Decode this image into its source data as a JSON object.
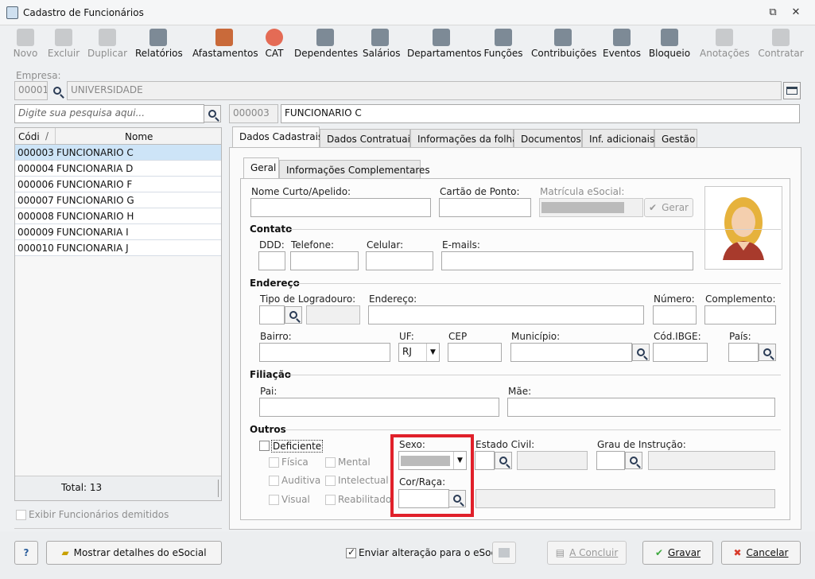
{
  "window": {
    "title": "Cadastro de Funcionários"
  },
  "toolbar": [
    {
      "label": "Novo",
      "icon": "new-doc-icon",
      "enabled": false
    },
    {
      "label": "Excluir",
      "icon": "trash-icon",
      "enabled": false
    },
    {
      "label": "Duplicar",
      "icon": "duplicate-users-icon",
      "enabled": false
    },
    {
      "label": "Relatórios",
      "icon": "report-icon",
      "enabled": true
    },
    {
      "label": "Afastamentos",
      "icon": "house-arrow-icon",
      "enabled": true
    },
    {
      "label": "CAT",
      "icon": "red-cross-icon",
      "enabled": true
    },
    {
      "label": "Dependentes",
      "icon": "dependents-icon",
      "enabled": true
    },
    {
      "label": "Salários",
      "icon": "money-icon",
      "enabled": true
    },
    {
      "label": "Departamentos",
      "icon": "desk-icon",
      "enabled": true
    },
    {
      "label": "Funções",
      "icon": "clipboard-icon",
      "enabled": true
    },
    {
      "label": "Contribuições",
      "icon": "heads-icon",
      "enabled": true
    },
    {
      "label": "Eventos",
      "icon": "list-icon",
      "enabled": true
    },
    {
      "label": "Bloqueio",
      "icon": "lock-icon",
      "enabled": true
    },
    {
      "label": "Anotações",
      "icon": "note-check-icon",
      "enabled": false
    },
    {
      "label": "Contratar",
      "icon": "contract-check-icon",
      "enabled": false
    }
  ],
  "empresa": {
    "label": "Empresa:",
    "code": "00001",
    "name": "UNIVERSIDADE"
  },
  "search": {
    "placeholder": "Digite sua pesquisa aqui..."
  },
  "current": {
    "code": "000003",
    "name": "FUNCIONARIO C"
  },
  "list": {
    "col_code": "Códi",
    "col_name": "Nome",
    "rows": [
      {
        "code": "000003",
        "name": "FUNCIONARIO C",
        "selected": true
      },
      {
        "code": "000004",
        "name": "FUNCIONARIA D"
      },
      {
        "code": "000006",
        "name": "FUNCIONARIO F"
      },
      {
        "code": "000007",
        "name": "FUNCIONARIO G"
      },
      {
        "code": "000008",
        "name": "FUNCIONARIO H"
      },
      {
        "code": "000009",
        "name": "FUNCIONARIA I"
      },
      {
        "code": "000010",
        "name": "FUNCIONARIA J"
      }
    ],
    "total": "Total: 13"
  },
  "exibir_demitidos": "Exibir Funcionários demitidos",
  "main_tabs": [
    "Dados Cadastrais",
    "Dados Contratuais",
    "Informações da folha",
    "Documentos",
    "Inf. adicionais",
    "Gestão"
  ],
  "sub_tabs": [
    "Geral",
    "Informações Complementares"
  ],
  "form": {
    "nome_curto": "Nome Curto/Apelido:",
    "cartao": "Cartão de Ponto:",
    "matricula": "Matrícula eSocial:",
    "gerar": "Gerar",
    "contato": "Contato",
    "ddd": "DDD:",
    "telefone": "Telefone:",
    "celular": "Celular:",
    "emails": "E-mails:",
    "endereco_sec": "Endereço",
    "tipo_logradouro": "Tipo de Logradouro:",
    "endereco": "Endereço:",
    "numero": "Número:",
    "complemento": "Complemento:",
    "bairro": "Bairro:",
    "uf": "UF:",
    "uf_value": "RJ",
    "cep": "CEP",
    "municipio": "Município:",
    "cod_ibge": "Cód.IBGE:",
    "pais": "País:",
    "filiacao": "Filiação",
    "pai": "Pai:",
    "mae": "Mãe:",
    "outros": "Outros",
    "deficiente": "Deficiente",
    "fisica": "Física",
    "mental": "Mental",
    "auditiva": "Auditiva",
    "intelectual": "Intelectual",
    "visual": "Visual",
    "reabilitado": "Reabilitado",
    "sexo": "Sexo:",
    "estado_civil": "Estado Civil:",
    "grau": "Grau de Instrução:",
    "cor_raca": "Cor/Raça:"
  },
  "footer": {
    "help": "?",
    "esocial_details": "Mostrar detalhes do eSocial",
    "enviar": "Enviar alteração para o eSocial",
    "concluir": "A Concluir",
    "gravar": "Gravar",
    "cancelar": "Cancelar"
  },
  "colors": {
    "highlight_box": "#e0202a",
    "selected_row": "#cde4f7"
  }
}
